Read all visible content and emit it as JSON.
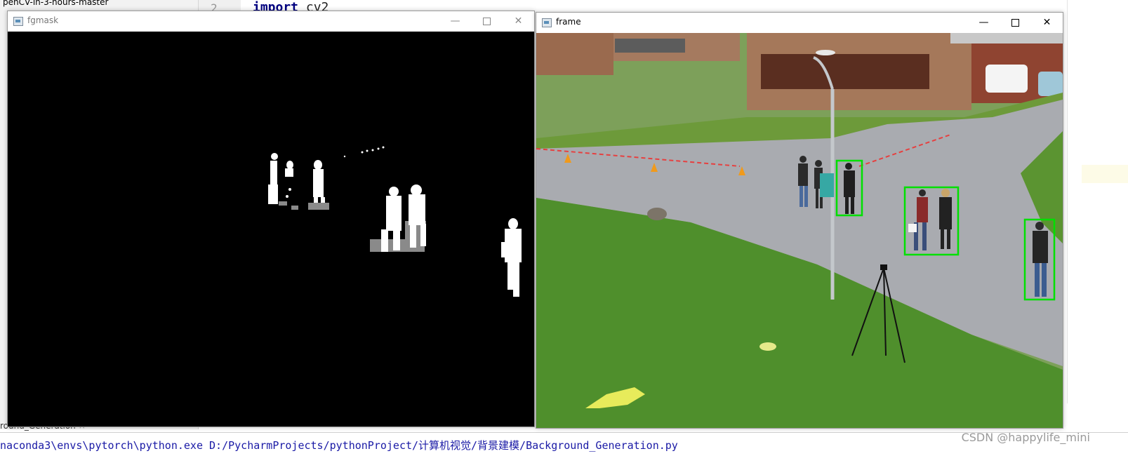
{
  "ide": {
    "project_title": "penCV-in-3-hours-master",
    "line_number": "2",
    "code_keyword": "import",
    "code_rest": " cv2",
    "run_tab": "round_Generation",
    "run_command": "naconda3\\envs\\pytorch\\python.exe D:/PycharmProjects/pythonProject/计算机视觉/背景建模/Background_Generation.py",
    "watermark": "CSDN @happylife_mini"
  },
  "windows": {
    "fgmask": {
      "title": "fgmask",
      "minimize": "—",
      "close": "✕"
    },
    "frame": {
      "title": "frame",
      "minimize": "—",
      "close": "✕",
      "detection_box_color": "#00e000",
      "detections_count": 4
    }
  },
  "icons": {
    "window_icon": "opencv-window-icon",
    "minimize": "minimize-icon",
    "maximize": "maximize-icon",
    "close": "close-icon"
  },
  "colors": {
    "mask_background": "#000000",
    "mask_foreground": "#ffffff",
    "mask_shadow": "#8a8a8a",
    "grass": "#4f8f2c",
    "road": "#a9abb0"
  }
}
